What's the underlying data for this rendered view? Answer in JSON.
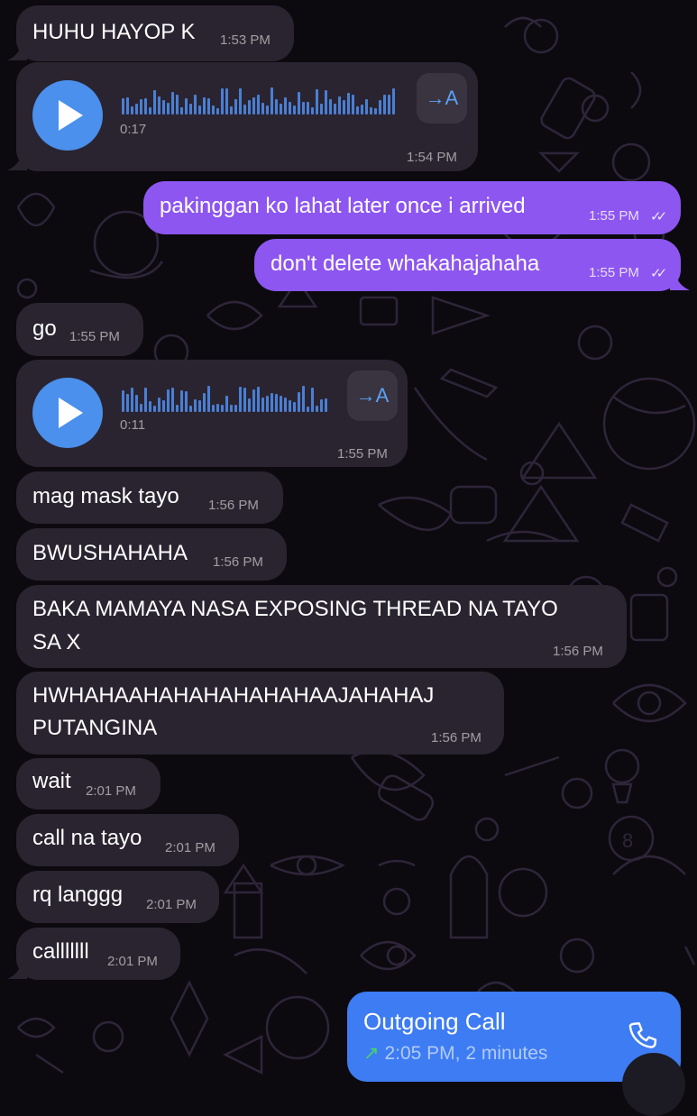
{
  "messages": [
    {
      "id": "m1",
      "text": "HUHU HAYOP K",
      "time": "1:53 PM"
    },
    {
      "id": "m2",
      "duration": "0:17",
      "time": "1:54 PM",
      "translate_label": "→A"
    },
    {
      "id": "m3",
      "text": "pakinggan ko lahat later once i arrived",
      "time": "1:55 PM"
    },
    {
      "id": "m4",
      "text": "don't delete whakahajahaha",
      "time": "1:55 PM"
    },
    {
      "id": "m5",
      "text": "go",
      "time": "1:55 PM"
    },
    {
      "id": "m6",
      "duration": "0:11",
      "time": "1:55 PM",
      "translate_label": "→A"
    },
    {
      "id": "m7",
      "text": "mag mask tayo",
      "time": "1:56 PM"
    },
    {
      "id": "m8",
      "text": "BWUSHAHAHA",
      "time": "1:56 PM"
    },
    {
      "id": "m9",
      "line1": "BAKA MAMAYA NASA EXPOSING THREAD NA TAYO",
      "line2": "SA X",
      "time": "1:56 PM"
    },
    {
      "id": "m10",
      "line1": "HWHAHAAHAHAHAHAHAHAAJAHAHAJ",
      "line2": "PUTANGINA",
      "time": "1:56 PM"
    },
    {
      "id": "m11",
      "text": "wait",
      "time": "2:01 PM"
    },
    {
      "id": "m12",
      "text": "call na tayo",
      "time": "2:01 PM"
    },
    {
      "id": "m13",
      "text": "rq langgg",
      "time": "2:01 PM"
    },
    {
      "id": "m14",
      "text": "calllllll",
      "time": "2:01 PM"
    }
  ],
  "call": {
    "title": "Outgoing Call",
    "arrow": "↗",
    "detail": "2:05 PM, 2 minutes"
  },
  "read_ticks": "✓✓",
  "colors": {
    "background": "#0c0a0f",
    "incoming_bubble": "#2a2430",
    "outgoing_bubble": "#8d56f0",
    "play_button": "#4a90ec",
    "call_bubble": "#3d7cf2"
  }
}
